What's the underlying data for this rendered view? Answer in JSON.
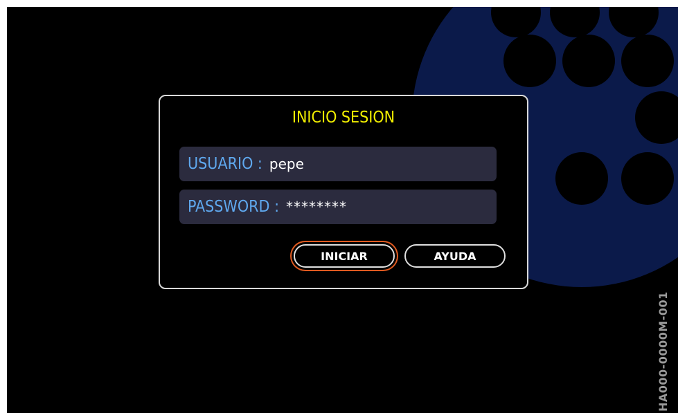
{
  "colors": {
    "background": "#000000",
    "title": "#f3f000",
    "label": "#5fa8ee",
    "field_bg": "#2b2b3e",
    "logo": "#0b1a4a",
    "focus_ring": "#e05a20"
  },
  "dialog": {
    "title": "INICIO SESION",
    "username": {
      "label": "USUARIO :",
      "value": "pepe"
    },
    "password": {
      "label": "PASSWORD :",
      "value": "********"
    },
    "buttons": {
      "login": "INICIAR",
      "help": "AYUDA"
    }
  },
  "background_logo": {
    "icon": "brand-logo-icon"
  },
  "watermark": "HA000-0000M-001"
}
